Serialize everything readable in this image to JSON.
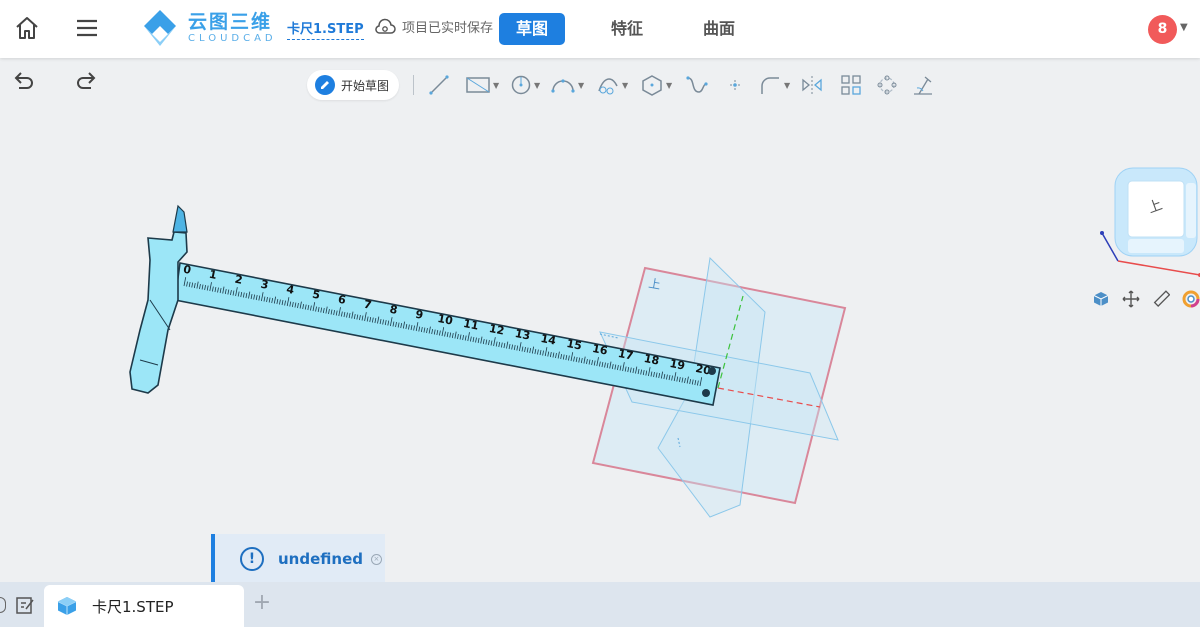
{
  "header": {
    "logo_cn": "云图三维",
    "logo_en": "CLOUDCAD",
    "file_name": "卡尺1.STEP",
    "save_status": "项目已实时保存",
    "tabs": [
      {
        "label": "草图",
        "active": true
      },
      {
        "label": "特征",
        "active": false
      },
      {
        "label": "曲面",
        "active": false
      }
    ],
    "avatar_text": "8"
  },
  "toolbar": {
    "start_sketch_label": "开始草图"
  },
  "viewport": {
    "ruler_numbers": [
      "0",
      "1",
      "2",
      "3",
      "4",
      "5",
      "6",
      "7",
      "8",
      "9",
      "10",
      "11",
      "12",
      "13",
      "14",
      "15",
      "16",
      "17",
      "18",
      "19",
      "20"
    ],
    "plane_label": "上",
    "cube_label": "上"
  },
  "notification": {
    "text": "undefined"
  },
  "bottom": {
    "doc_tab_label": "卡尺1.STEP",
    "add_symbol": "+"
  },
  "colors": {
    "accent": "#1e7fe0",
    "avatar": "#f15a5a",
    "part": "#9ce6f7",
    "plane_outline": "#d9879a",
    "plane_fill": "#bfe3f7"
  }
}
